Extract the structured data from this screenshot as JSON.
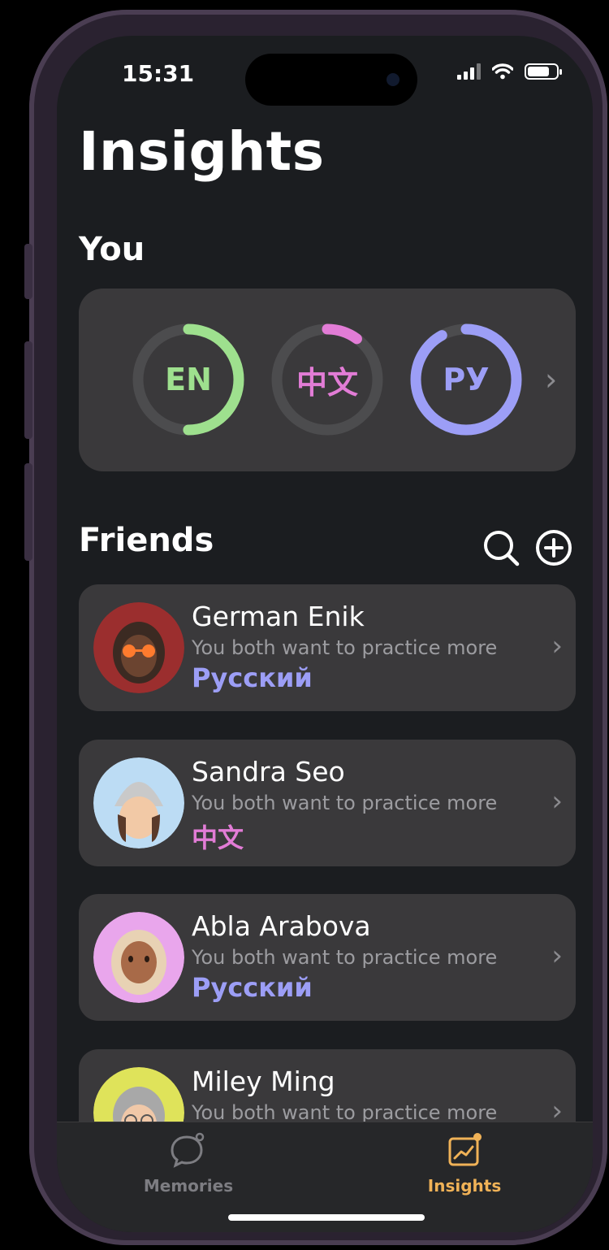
{
  "status": {
    "time": "15:31"
  },
  "page": {
    "title": "Insights"
  },
  "you": {
    "heading": "You",
    "languages": [
      {
        "code": "EN",
        "color": "#9ee08e",
        "progress": 0.5
      },
      {
        "code": "中文",
        "color": "#e27cd6",
        "progress": 0.1
      },
      {
        "code": "РУ",
        "color": "#9c9ef6",
        "progress": 0.92
      }
    ]
  },
  "friends": {
    "heading": "Friends",
    "items": [
      {
        "name": "German Enik",
        "subtitle": "You both want to practice more",
        "language": "Русский",
        "language_color": "#9c9ef6",
        "avatar_bg": "#9b2e2e"
      },
      {
        "name": "Sandra Seo",
        "subtitle": "You both want to practice more",
        "language": "中文",
        "language_color": "#e27cd6",
        "avatar_bg": "#bcdcf4"
      },
      {
        "name": "Abla Arabova",
        "subtitle": "You both want to practice more",
        "language": "Русский",
        "language_color": "#9c9ef6",
        "avatar_bg": "#e9a6ec"
      },
      {
        "name": "Miley Ming",
        "subtitle": "You both want to practice more",
        "language": "",
        "language_color": "#e27cd6",
        "avatar_bg": "#dfe35a"
      }
    ]
  },
  "tabs": [
    {
      "label": "Memories",
      "icon": "memories-bubble-icon",
      "active": false
    },
    {
      "label": "Insights",
      "icon": "insights-chart-icon",
      "active": true
    }
  ],
  "colors": {
    "accent": "#f0b257",
    "card": "#3a393b",
    "background": "#1b1d20"
  }
}
